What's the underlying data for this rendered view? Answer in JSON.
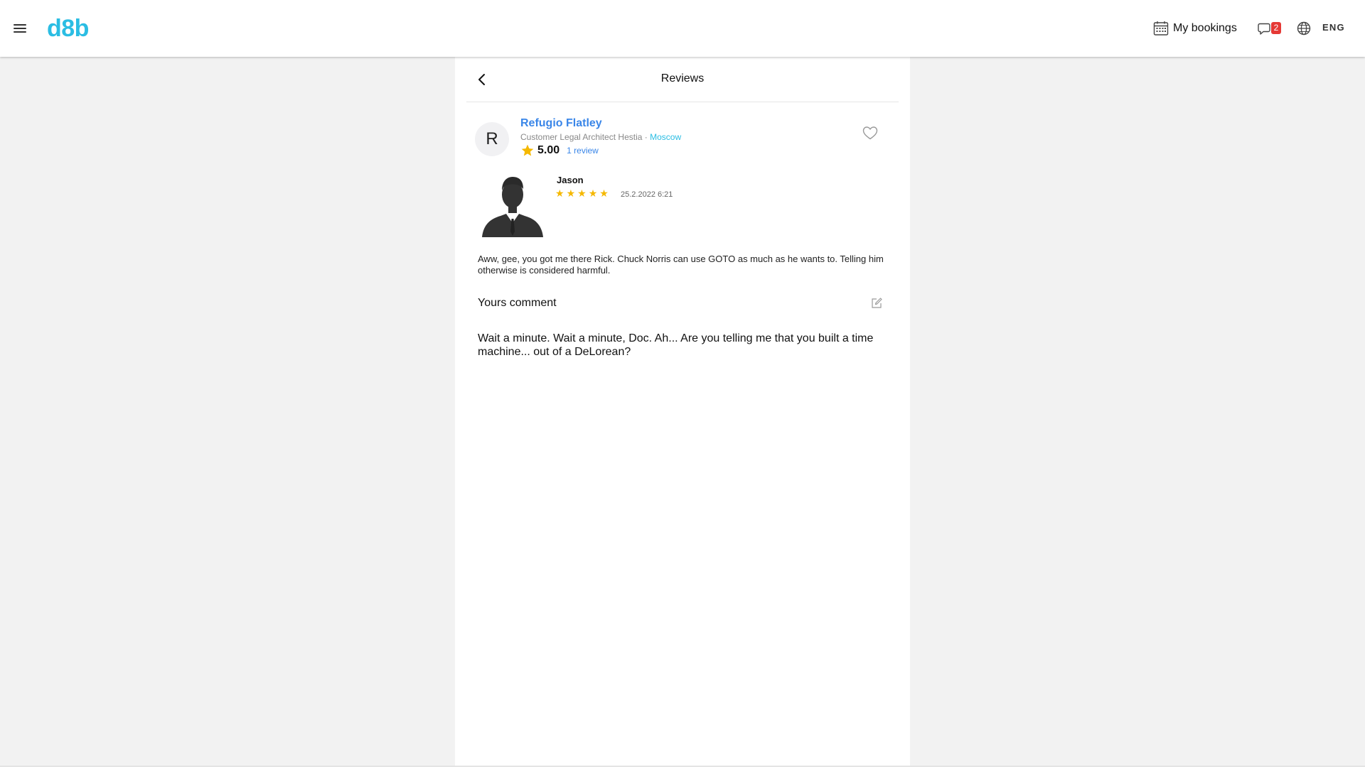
{
  "header": {
    "logo": "d8b",
    "bookings_label": "My bookings",
    "chat_badge": "2",
    "language": "ENG",
    "icons": {
      "menu": "menu-icon",
      "bookings": "calendar-icon",
      "chat": "chat-icon",
      "language": "globe-icon"
    }
  },
  "page": {
    "title": "Reviews"
  },
  "specialist": {
    "initial": "R",
    "name": "Refugio Flatley",
    "subtitle": "Customer Legal Architect Hestia",
    "separator": " · ",
    "city": "Moscow",
    "rating": "5.00",
    "reviews_count": "1 review"
  },
  "review": {
    "author": "Jason",
    "stars": 5,
    "date": "25.2.2022 6:21",
    "text": "Aww, gee, you got me there Rick. Chuck Norris can use GOTO as much as he wants to. Telling him otherwise is considered harmful."
  },
  "comment": {
    "label": "Yours comment",
    "text": "Wait a minute. Wait a minute, Doc. Ah... Are you telling me that you built a time machine... out of a DeLorean?"
  },
  "colors": {
    "brand": "#2bbde3",
    "link": "#3a86e8",
    "star": "#f5b800",
    "badge": "#e53935"
  }
}
